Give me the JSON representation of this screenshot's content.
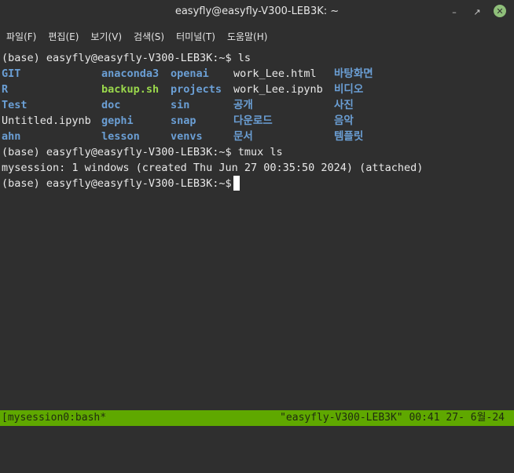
{
  "window": {
    "title": "easyfly@easyfly-V300-LEB3K: ~"
  },
  "menubar": {
    "items": [
      "파일(F)",
      "편집(E)",
      "보기(V)",
      "검색(S)",
      "터미널(T)",
      "도움말(H)"
    ]
  },
  "terminal": {
    "prompt1": "(base) easyfly@easyfly-V300-LEB3K:~$ ls",
    "ls_grid": [
      [
        "GIT",
        "anaconda3",
        "openai",
        "work_Lee.html",
        "바탕화면"
      ],
      [
        "R",
        "backup.sh",
        "projects",
        "work_Lee.ipynb",
        "비디오"
      ],
      [
        "Test",
        "doc",
        "sin",
        "공개",
        "사진"
      ],
      [
        "Untitled.ipynb",
        "gephi",
        "snap",
        "다운로드",
        "음악"
      ],
      [
        "ahn",
        "lesson",
        "venvs",
        "문서",
        "템플릿"
      ]
    ],
    "prompt2": "(base) easyfly@easyfly-V300-LEB3K:~$ tmux ls",
    "output": "mysession: 1 windows (created Thu Jun 27 00:35:50 2024) (attached)",
    "prompt3": "(base) easyfly@easyfly-V300-LEB3K:~$ "
  },
  "statusbar": {
    "left": "[mysession0:bash*",
    "right": "\"easyfly-V300-LEB3K\" 00:41 27- 6월-24"
  },
  "colors": {
    "directory": "#6b9fd5",
    "executable": "#9ad84c",
    "file": "#e8e8e8",
    "statusbar_bg": "#5fa800"
  }
}
